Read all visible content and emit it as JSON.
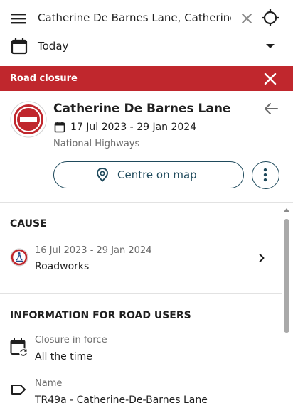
{
  "search": {
    "value": "Catherine De Barnes Lane, Catherine"
  },
  "date_filter": {
    "value": "Today"
  },
  "banner": {
    "title": "Road closure",
    "color": "#c0272d"
  },
  "closure": {
    "title": "Catherine De Barnes Lane",
    "dates": "17 Jul 2023 - 29 Jan 2024",
    "authority": "National Highways",
    "centre_label": "Centre on map"
  },
  "cause": {
    "heading": "CAUSE",
    "dates": "16 Jul 2023 - 29 Jan 2024",
    "type": "Roadworks"
  },
  "info": {
    "heading": "INFORMATION FOR ROAD USERS",
    "items": [
      {
        "label": "Closure in force",
        "value": "All the time",
        "icon": "calendar-sync-icon"
      },
      {
        "label": "Name",
        "value": "TR49a - Catherine-De-Barnes Lane",
        "icon": "label-icon"
      }
    ]
  },
  "colors": {
    "accent": "#c0272d",
    "teal": "#1f4a5c"
  }
}
